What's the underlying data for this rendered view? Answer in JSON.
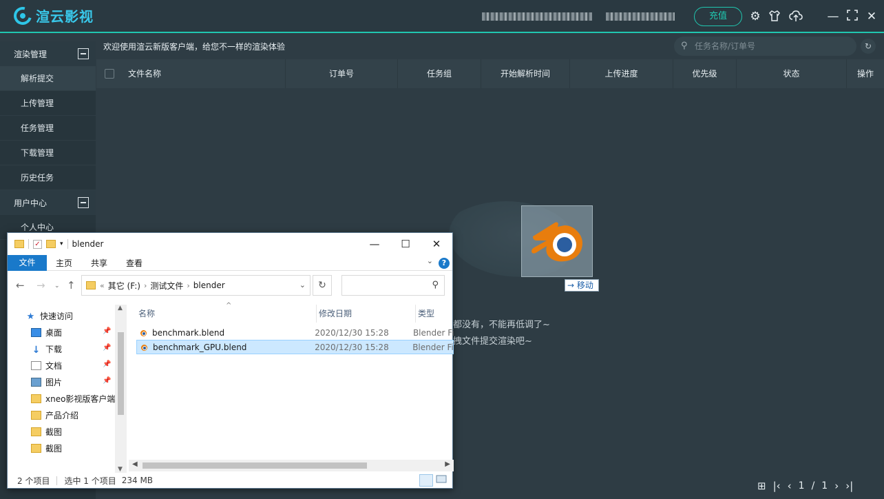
{
  "app": {
    "brand": "渲云影视",
    "user_info_1": "",
    "user_info_2": "",
    "recharge_label": "充值",
    "icons": [
      "gear-icon",
      "shirt-icon",
      "cloud-upload-icon",
      "minimize-icon",
      "maximize-icon",
      "close-icon"
    ]
  },
  "sidebar": {
    "groups": [
      {
        "label": "渲染管理",
        "items": [
          "解析提交",
          "上传管理",
          "任务管理",
          "下载管理",
          "历史任务"
        ]
      },
      {
        "label": "用户中心",
        "items": [
          "个人中心"
        ]
      }
    ]
  },
  "main": {
    "welcome": "欢迎使用渲云新版客户端，给您不一样的渲染体验",
    "search_placeholder": "任务名称/订单号",
    "columns": [
      "文件名称",
      "订单号",
      "任务组",
      "开始解析时间",
      "上传进度",
      "优先级",
      "状态",
      "操作"
    ],
    "empty_line1": "都没有，不能再低调了~",
    "empty_line2": "拽文件提交渲染吧~",
    "drag_hint": "→ 移动",
    "pager": {
      "current": "1",
      "sep": "/",
      "total": "1"
    }
  },
  "explorer": {
    "title": "blender",
    "tabs": [
      "文件",
      "主页",
      "共享",
      "查看"
    ],
    "path": [
      "其它 (F:)",
      "测试文件",
      "blender"
    ],
    "nav": [
      {
        "label": "快速访问",
        "icon": "star-icon"
      },
      {
        "label": "桌面",
        "icon": "desktop-icon",
        "pinned": true
      },
      {
        "label": "下载",
        "icon": "download-icon",
        "pinned": true
      },
      {
        "label": "文档",
        "icon": "document-icon",
        "pinned": true
      },
      {
        "label": "图片",
        "icon": "picture-icon",
        "pinned": true
      },
      {
        "label": "xneo影视版客户端",
        "icon": "folder-icon"
      },
      {
        "label": "产品介绍",
        "icon": "folder-icon"
      },
      {
        "label": "截图",
        "icon": "folder-icon"
      },
      {
        "label": "截图",
        "icon": "folder-icon"
      }
    ],
    "columns": [
      "名称",
      "修改日期",
      "类型"
    ],
    "files": [
      {
        "name": "benchmark.blend",
        "date": "2020/12/30 15:28",
        "type": "Blender File"
      },
      {
        "name": "benchmark_GPU.blend",
        "date": "2020/12/30 15:28",
        "type": "Blender File"
      }
    ],
    "status": {
      "count": "2 个项目",
      "selected": "选中 1 个项目",
      "size": "234 MB"
    }
  }
}
